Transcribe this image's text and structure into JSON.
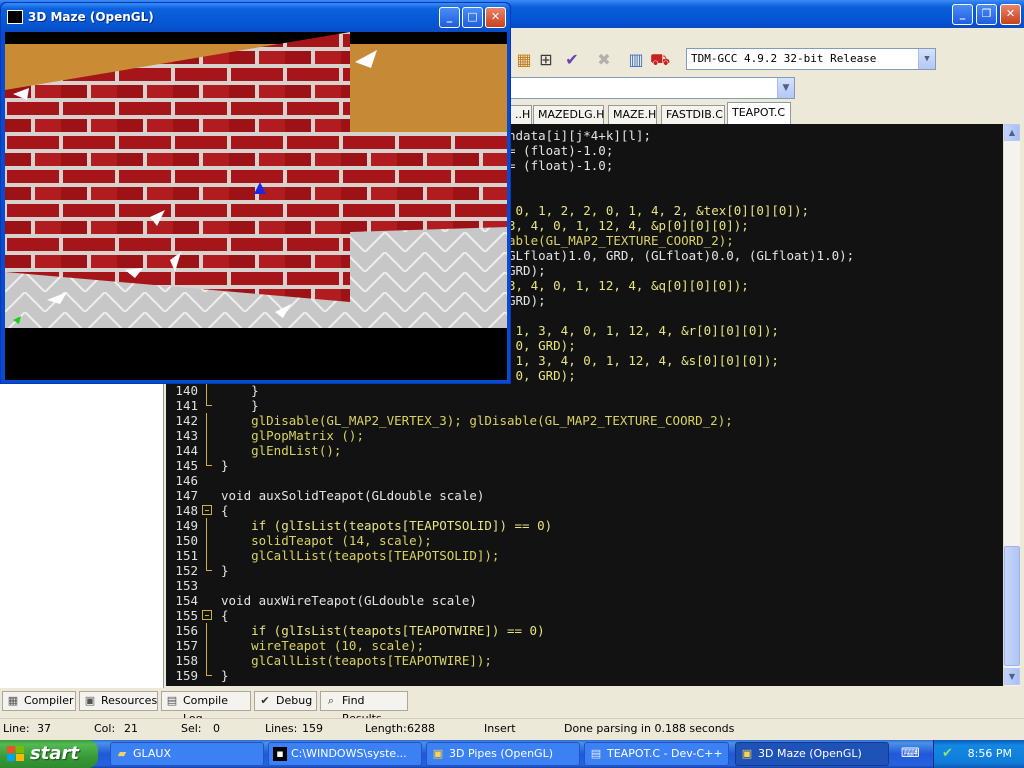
{
  "devcpp": {
    "toolbar": {
      "compiler": "TDM-GCC 4.9.2 32-bit Release",
      "icons": [
        "grid-icon",
        "check-icon",
        "cross-icon",
        "chart-icon",
        "profile-icon"
      ]
    },
    "tabs": [
      {
        "label": "..H",
        "active": false
      },
      {
        "label": "MAZEDLG.H",
        "active": false
      },
      {
        "label": "MAZE.H",
        "active": false
      },
      {
        "label": "FASTDIB.C",
        "active": false
      },
      {
        "label": "TEAPOT.C",
        "active": true
      }
    ],
    "code_lines": [
      {
        "n": "",
        "text": "ndata[i][j*4+k][l];"
      },
      {
        "n": "",
        "text": "= (float)-1.0;"
      },
      {
        "n": "",
        "text": "= (float)-1.0;"
      },
      {
        "n": "",
        "text": ""
      },
      {
        "n": "",
        "text": ""
      },
      {
        "n": "",
        "text": " 0, 1, 2, 2, 0, 1, 4, 2, &tex[0][0][0]);"
      },
      {
        "n": "",
        "text": "3, 4, 0, 1, 12, 4, &p[0][0][0]);"
      },
      {
        "n": "",
        "text": "able(GL_MAP2_TEXTURE_COORD_2);"
      },
      {
        "n": "",
        "text": "GLfloat)1.0, GRD, (GLfloat)0.0, (GLfloat)1.0);"
      },
      {
        "n": "",
        "text": "GRD);"
      },
      {
        "n": "",
        "text": "3, 4, 0, 1, 12, 4, &q[0][0][0]);"
      },
      {
        "n": "",
        "text": "GRD);"
      },
      {
        "n": "",
        "text": ""
      },
      {
        "n": "",
        "text": " 1, 3, 4, 0, 1, 12, 4, &r[0][0][0]);"
      },
      {
        "n": "",
        "text": " 0, GRD);"
      },
      {
        "n": "",
        "text": " 1, 3, 4, 0, 1, 12, 4, &s[0][0][0]);"
      },
      {
        "n": "",
        "text": " 0, GRD);"
      },
      {
        "n": "140",
        "text": "    }"
      },
      {
        "n": "141",
        "text": "    }"
      },
      {
        "n": "142",
        "text": "    glDisable(GL_MAP2_VERTEX_3); glDisable(GL_MAP2_TEXTURE_COORD_2);"
      },
      {
        "n": "143",
        "text": "    glPopMatrix ();"
      },
      {
        "n": "144",
        "text": "    glEndList();"
      },
      {
        "n": "145",
        "text": "}"
      },
      {
        "n": "146",
        "text": ""
      },
      {
        "n": "147",
        "text": "void auxSolidTeapot(GLdouble scale)"
      },
      {
        "n": "148",
        "text": "{"
      },
      {
        "n": "149",
        "text": "    if (glIsList(teapots[TEAPOTSOLID]) == 0)"
      },
      {
        "n": "150",
        "text": "    solidTeapot (14, scale);"
      },
      {
        "n": "151",
        "text": "    glCallList(teapots[TEAPOTSOLID]);"
      },
      {
        "n": "152",
        "text": "}"
      },
      {
        "n": "153",
        "text": ""
      },
      {
        "n": "154",
        "text": "void auxWireTeapot(GLdouble scale)"
      },
      {
        "n": "155",
        "text": "{"
      },
      {
        "n": "156",
        "text": "    if (glIsList(teapots[TEAPOTWIRE]) == 0)"
      },
      {
        "n": "157",
        "text": "    wireTeapot (10, scale);"
      },
      {
        "n": "158",
        "text": "    glCallList(teapots[TEAPOTWIRE]);"
      },
      {
        "n": "159",
        "text": "}"
      }
    ],
    "bottom_tabs": [
      {
        "label": "Compiler",
        "icon": "compiler-grid-icon"
      },
      {
        "label": "Resources",
        "icon": "resources-icon"
      },
      {
        "label": "Compile Log",
        "icon": "compile-log-icon"
      },
      {
        "label": "Debug",
        "icon": "debug-check-icon"
      },
      {
        "label": "Find Results",
        "icon": "find-results-icon"
      }
    ],
    "status": {
      "line_label": "Line:",
      "line_value": "37",
      "col_label": "Col:",
      "col_value": "21",
      "sel_label": "Sel:",
      "sel_value": "0",
      "lines_label": "Lines:",
      "lines_value": "159",
      "length_label": "Length:",
      "length_value": "6288",
      "mode": "Insert",
      "message": "Done parsing in 0.188 seconds"
    }
  },
  "maze_window": {
    "title": "3D Maze (OpenGL)"
  },
  "taskbar": {
    "start_label": "start",
    "tasks": [
      {
        "label": "GLAUX",
        "icon": "folder-icon",
        "active": false
      },
      {
        "label": "C:\\WINDOWS\\syste...",
        "icon": "cmd-icon",
        "active": false
      },
      {
        "label": "3D Pipes (OpenGL)",
        "icon": "screensaver-icon",
        "active": false
      },
      {
        "label": "TEAPOT.C - Dev-C++",
        "icon": "devcpp-icon",
        "active": false
      },
      {
        "label": "3D Maze (OpenGL)",
        "icon": "screensaver-icon",
        "active": true
      }
    ],
    "clock": "8:56 PM"
  }
}
